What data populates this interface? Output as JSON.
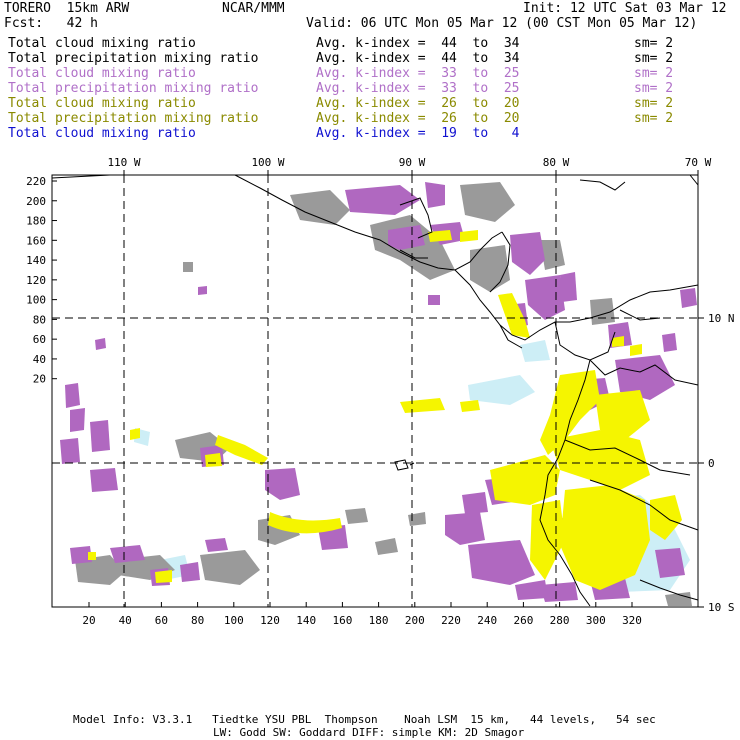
{
  "header": {
    "model": "TORERO  15km ARW",
    "org": "NCAR/MMM",
    "init": "Init: 12 UTC Sat 03 Mar 12",
    "fcst": "Fcst:   42 h",
    "valid": "Valid: 06 UTC Mon 05 Mar 12 (00 CST Mon 05 Mar 12)"
  },
  "legend": [
    {
      "field": "Total cloud mixing ratio",
      "index": "Avg. k-index =  44  to  34",
      "sm": "sm= 2",
      "color": "#000000"
    },
    {
      "field": "Total precipitation mixing ratio",
      "index": "Avg. k-index =  44  to  34",
      "sm": "sm= 2",
      "color": "#000000"
    },
    {
      "field": "Total cloud mixing ratio",
      "index": "Avg. k-index =  33  to  25",
      "sm": "sm= 2",
      "color": "#b070c8"
    },
    {
      "field": "Total precipitation mixing ratio",
      "index": "Avg. k-index =  33  to  25",
      "sm": "sm= 2",
      "color": "#b070c8"
    },
    {
      "field": "Total cloud mixing ratio",
      "index": "Avg. k-index =  26  to  20",
      "sm": "sm= 2",
      "color": "#8a8a00"
    },
    {
      "field": "Total precipitation mixing ratio",
      "index": "Avg. k-index =  26  to  20",
      "sm": "sm= 2",
      "color": "#8a8a00"
    },
    {
      "field": "Total cloud mixing ratio",
      "index": "Avg. k-index =  19  to   4",
      "sm": "",
      "color": "#1010d0"
    }
  ],
  "axes": {
    "lon_labels": [
      "110 W",
      "100 W",
      "90 W",
      "80 W",
      "70 W"
    ],
    "lat_labels": [
      "10 N",
      "0",
      "10 S"
    ],
    "y_ticks": [
      "220",
      "200",
      "180",
      "160",
      "140",
      "120",
      "100",
      "80",
      "60",
      "40",
      "20"
    ],
    "x_ticks": [
      "20",
      "40",
      "60",
      "80",
      "100",
      "120",
      "140",
      "160",
      "180",
      "200",
      "220",
      "240",
      "260",
      "280",
      "300",
      "320"
    ]
  },
  "colors": {
    "gray": "#9a9a9a",
    "purple": "#b068c0",
    "yellow": "#f5f500",
    "lightblue": "#cdeef6"
  },
  "footer": {
    "line1": "Model Info: V3.3.1   Tiedtke YSU PBL  Thompson    Noah LSM  15 km,   44 levels,   54 sec",
    "line2": "LW: Godd SW: Goddard DIFF: simple KM: 2D Smagor"
  }
}
